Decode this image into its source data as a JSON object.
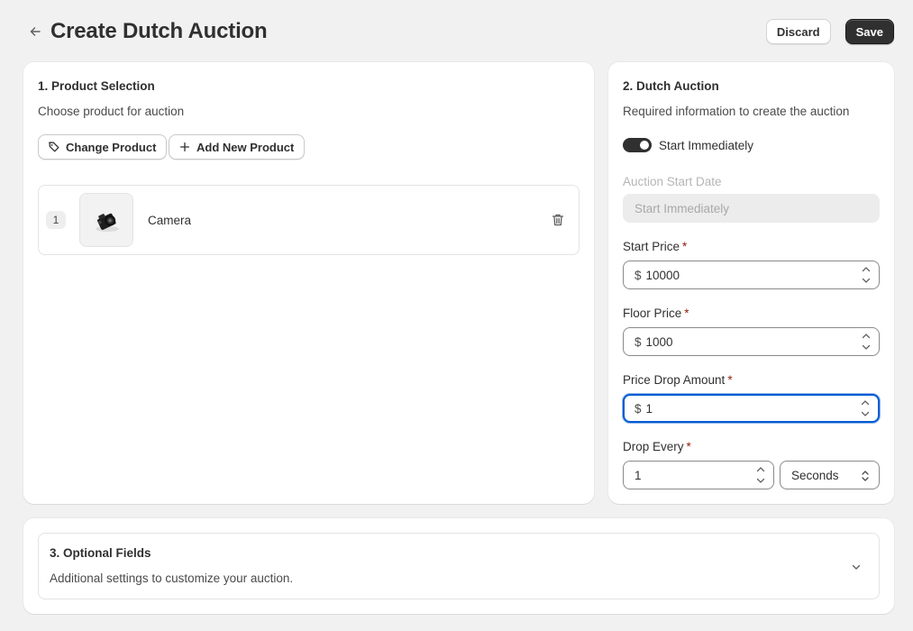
{
  "header": {
    "title": "Create Dutch Auction",
    "discard_label": "Discard",
    "save_label": "Save",
    "back_icon": "arrow-left-icon"
  },
  "product_selection": {
    "title": "1. Product Selection",
    "subtitle": "Choose product for auction",
    "change_product_label": "Change Product",
    "add_new_product_label": "Add New Product",
    "items": [
      {
        "index": "1",
        "name": "Camera"
      }
    ]
  },
  "dutch_auction": {
    "title": "2. Dutch Auction",
    "subtitle": "Required information to create the auction",
    "start_immediately": {
      "label": "Start Immediately",
      "checked": true
    },
    "auction_start_date": {
      "label": "Auction Start Date",
      "placeholder": "Start Immediately"
    },
    "start_price": {
      "label": "Start Price",
      "required_mark": "*",
      "prefix": "$",
      "value": "10000"
    },
    "floor_price": {
      "label": "Floor Price",
      "required_mark": "*",
      "prefix": "$",
      "value": "1000"
    },
    "price_drop_amount": {
      "label": "Price Drop Amount",
      "required_mark": "*",
      "prefix": "$",
      "value": "1"
    },
    "drop_every": {
      "label": "Drop Every",
      "required_mark": "*",
      "value": "1",
      "unit": "Seconds"
    }
  },
  "optional_fields": {
    "title": "3. Optional Fields",
    "subtitle": "Additional settings to customize your auction."
  },
  "colors": {
    "background": "#f1f1f1",
    "primary_button": "#303030",
    "focus_ring": "#005bd3",
    "required": "#8e1f0b"
  }
}
